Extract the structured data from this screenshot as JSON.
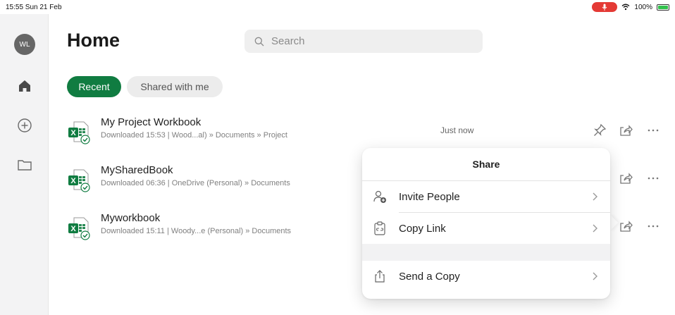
{
  "status_bar": {
    "time_date": "15:55  Sun 21 Feb",
    "battery": "100%"
  },
  "sidebar": {
    "avatar_initials": "WL"
  },
  "page": {
    "title": "Home"
  },
  "search": {
    "placeholder": "Search"
  },
  "tabs": [
    {
      "label": "Recent",
      "active": true
    },
    {
      "label": "Shared with me",
      "active": false
    }
  ],
  "files": [
    {
      "name": "My Project Workbook",
      "meta": "Downloaded 15:53 | Wood...al) » Documents » Project",
      "time": "Just now"
    },
    {
      "name": "MySharedBook",
      "meta": "Downloaded 06:36 | OneDrive (Personal) » Documents",
      "time": ""
    },
    {
      "name": "Myworkbook",
      "meta": "Downloaded 15:11 | Woody...e (Personal) » Documents",
      "time": ""
    }
  ],
  "share_menu": {
    "title": "Share",
    "items": [
      {
        "label": "Invite People",
        "icon": "invite-people-icon"
      },
      {
        "label": "Copy Link",
        "icon": "copy-link-icon"
      },
      {
        "label": "Send a Copy",
        "icon": "send-copy-icon"
      }
    ]
  },
  "colors": {
    "accent": "#107c41",
    "mic_indicator": "#e43a35",
    "battery": "#31c24c"
  }
}
